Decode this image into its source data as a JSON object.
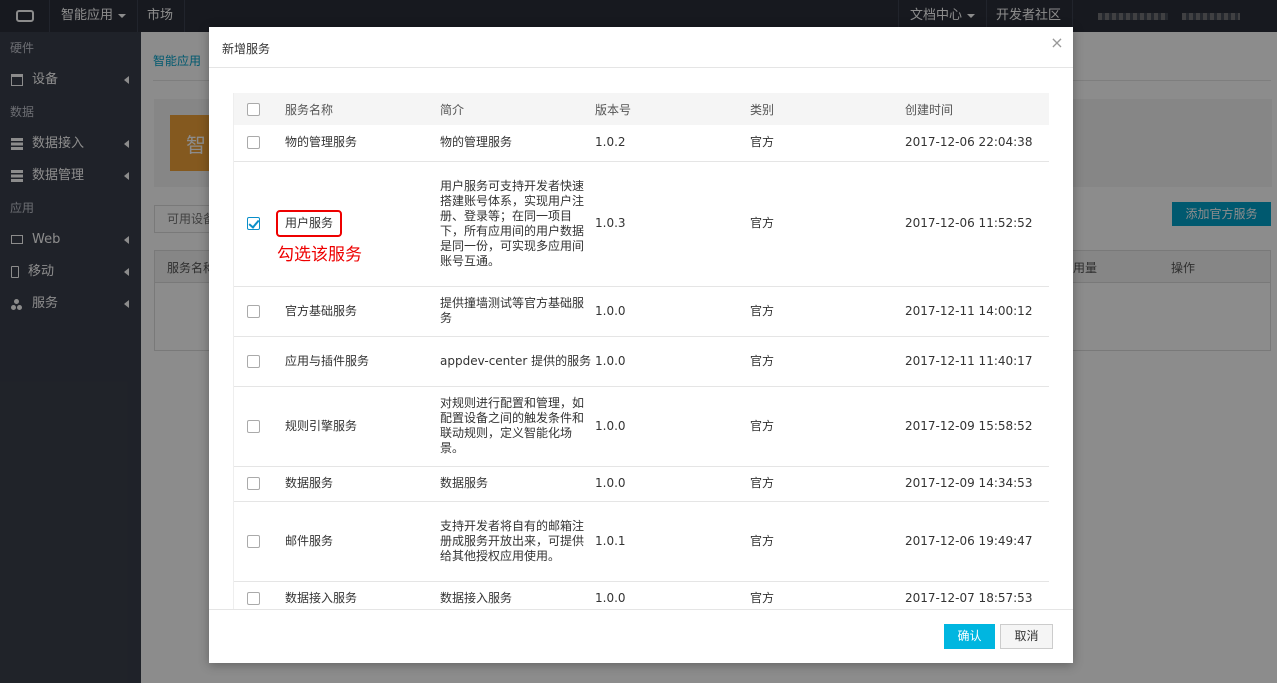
{
  "topbar": {
    "app_menu": "智能应用",
    "market": "市场",
    "docs": "文档中心",
    "dev_community": "开发者社区"
  },
  "sidebar": {
    "groups": [
      {
        "label": "硬件",
        "items": [
          {
            "label": "设备",
            "icon": "device-icon"
          }
        ]
      },
      {
        "label": "数据",
        "items": [
          {
            "label": "数据接入",
            "icon": "stack-icon"
          },
          {
            "label": "数据管理",
            "icon": "stack-icon"
          }
        ]
      },
      {
        "label": "应用",
        "items": [
          {
            "label": "Web",
            "icon": "monitor-icon"
          },
          {
            "label": "移动",
            "icon": "phone-icon"
          },
          {
            "label": "服务",
            "icon": "cluster-icon"
          }
        ]
      }
    ]
  },
  "background": {
    "breadcrumb": "智能应用",
    "banner_char": "智",
    "available_tab": "可用设备",
    "add_official_service": "添加官方服务",
    "table_headers": {
      "name": "服务名称",
      "usage": "用量",
      "actions": "操作"
    }
  },
  "modal": {
    "title": "新增服务",
    "columns": [
      "服务名称",
      "简介",
      "版本号",
      "类别",
      "创建时间"
    ],
    "rows": [
      {
        "name": "物的管理服务",
        "desc": "物的管理服务",
        "version": "1.0.2",
        "category": "官方",
        "created": "2017-12-06 22:04:38",
        "checked": false
      },
      {
        "name": "用户服务",
        "desc": "用户服务可支持开发者快速搭建账号体系，实现用户注册、登录等；在同一项目下，所有应用间的用户数据是同一份，可实现多应用间账号互通。",
        "version": "1.0.3",
        "category": "官方",
        "created": "2017-12-06 11:52:52",
        "checked": true
      },
      {
        "name": "官方基础服务",
        "desc": "提供撞墙测试等官方基础服务",
        "version": "1.0.0",
        "category": "官方",
        "created": "2017-12-11 14:00:12",
        "checked": false
      },
      {
        "name": "应用与插件服务",
        "desc": "appdev-center 提供的服务",
        "version": "1.0.0",
        "category": "官方",
        "created": "2017-12-11 11:40:17",
        "checked": false
      },
      {
        "name": "规则引擎服务",
        "desc": "对规则进行配置和管理，如配置设备之间的触发条件和联动规则，定义智能化场景。",
        "version": "1.0.0",
        "category": "官方",
        "created": "2017-12-09 15:58:52",
        "checked": false
      },
      {
        "name": "数据服务",
        "desc": "数据服务",
        "version": "1.0.0",
        "category": "官方",
        "created": "2017-12-09 14:34:53",
        "checked": false
      },
      {
        "name": "邮件服务",
        "desc": "支持开发者将自有的邮箱注册成服务开放出来，可提供给其他授权应用使用。",
        "version": "1.0.1",
        "category": "官方",
        "created": "2017-12-06 19:49:47",
        "checked": false
      },
      {
        "name": "数据接入服务",
        "desc": "数据接入服务",
        "version": "1.0.0",
        "category": "官方",
        "created": "2017-12-07 18:57:53",
        "checked": false
      }
    ],
    "annotation": "勾选该服务",
    "confirm": "确认",
    "cancel": "取消"
  },
  "colors": {
    "accent": "#00b6e0",
    "sidebar": "#3a3f4b",
    "topbar": "#2b2f3a",
    "annotation": "#ee0000"
  }
}
